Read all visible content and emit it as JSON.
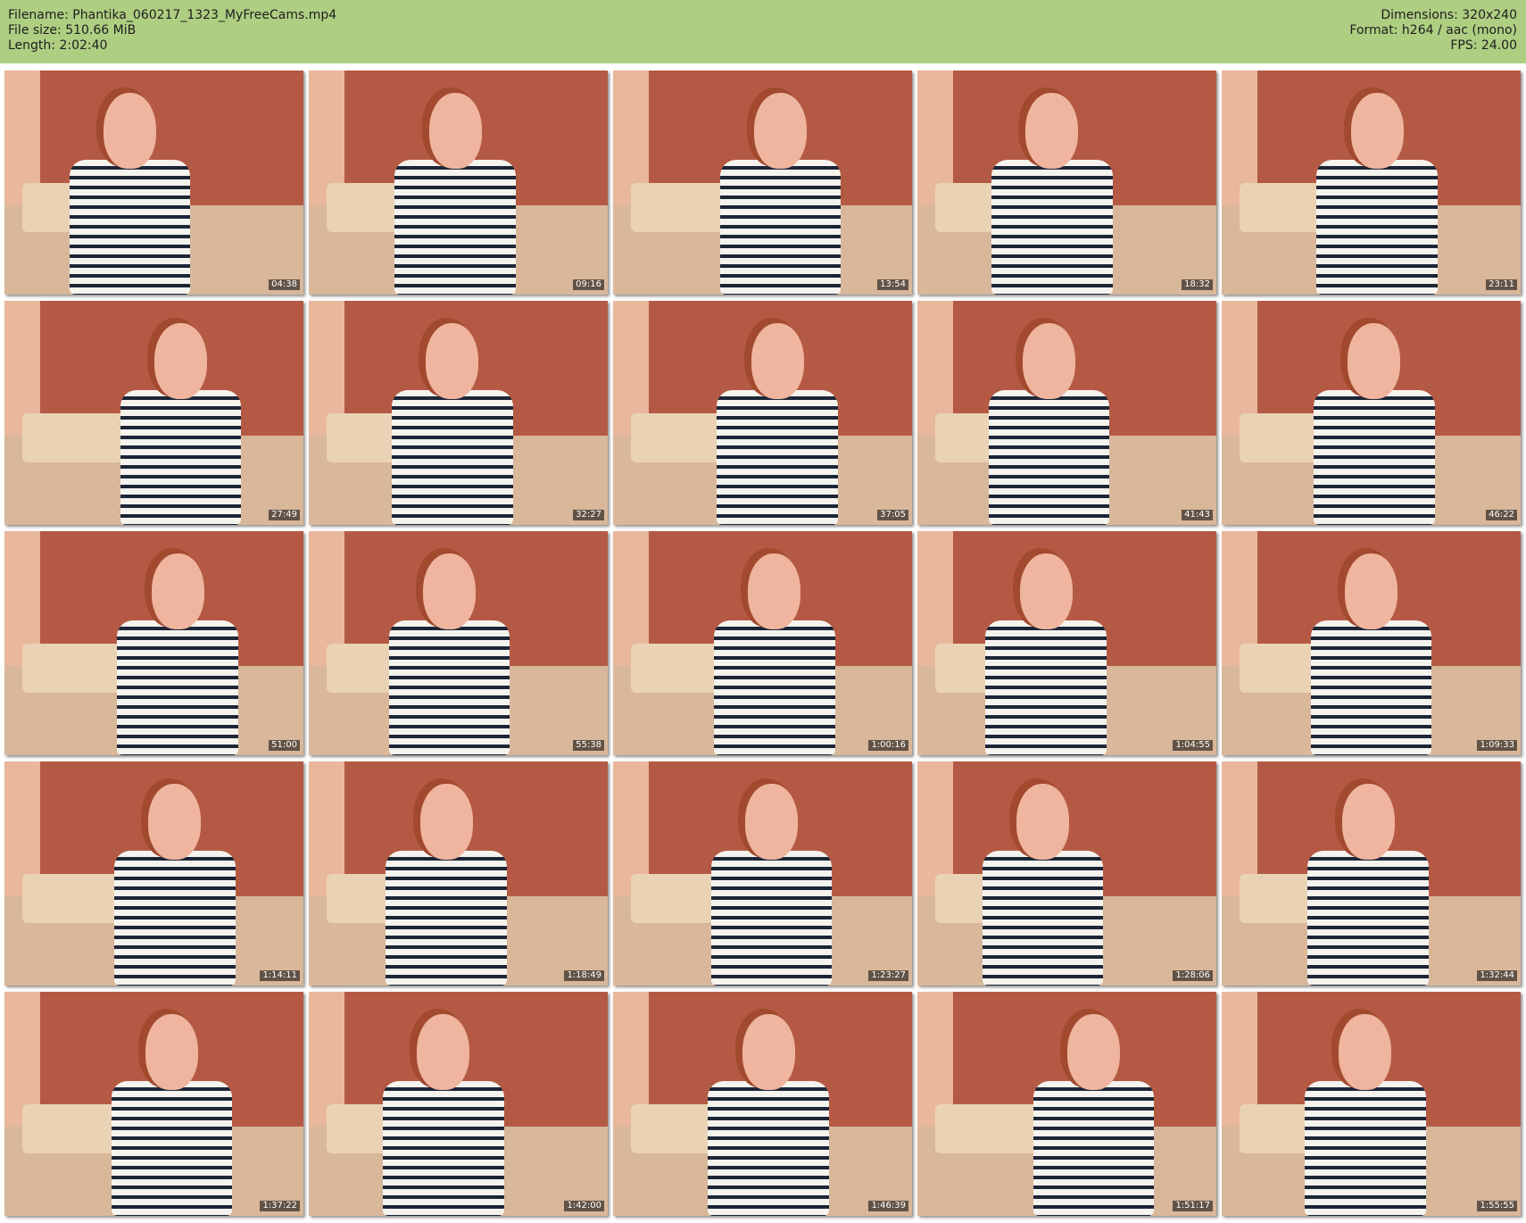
{
  "header": {
    "filename": "Filename: Phantika_060217_1323_MyFreeCams.mp4",
    "file_size": "File size: 510.66 MiB",
    "length": "Length: 2:02:40",
    "dimensions": "Dimensions: 320x240",
    "format": "Format: h264 / aac (mono)",
    "fps": "FPS: 24.00"
  },
  "colors": {
    "header_bg": "#aece82",
    "wall": "#b45a44",
    "wall_light": "#e8b79c",
    "floor": "#d9b79a",
    "sofa": "#ead2b4",
    "skin": "#efb59f",
    "hair": "#a24a2e"
  },
  "thumbnails": [
    {
      "timestamp": "04:38"
    },
    {
      "timestamp": "09:16"
    },
    {
      "timestamp": "13:54"
    },
    {
      "timestamp": "18:32"
    },
    {
      "timestamp": "23:11"
    },
    {
      "timestamp": "27:49"
    },
    {
      "timestamp": "32:27"
    },
    {
      "timestamp": "37:05"
    },
    {
      "timestamp": "41:43"
    },
    {
      "timestamp": "46:22"
    },
    {
      "timestamp": "51:00"
    },
    {
      "timestamp": "55:38"
    },
    {
      "timestamp": "1:00:16"
    },
    {
      "timestamp": "1:04:55"
    },
    {
      "timestamp": "1:09:33"
    },
    {
      "timestamp": "1:14:11"
    },
    {
      "timestamp": "1:18:49"
    },
    {
      "timestamp": "1:23:27"
    },
    {
      "timestamp": "1:28:06"
    },
    {
      "timestamp": "1:32:44"
    },
    {
      "timestamp": "1:37:22"
    },
    {
      "timestamp": "1:42:00"
    },
    {
      "timestamp": "1:46:39"
    },
    {
      "timestamp": "1:51:17"
    },
    {
      "timestamp": "1:55:55"
    }
  ]
}
